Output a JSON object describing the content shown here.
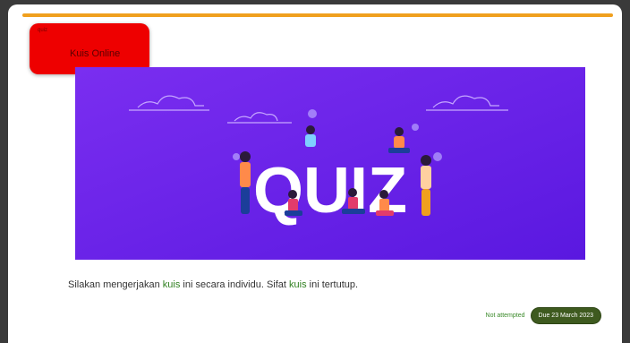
{
  "activity": {
    "tiny_label": "quiz",
    "title": "Kuis Online",
    "banner_word": "QUIZ",
    "description": {
      "part1": "Silakan mengerjakan ",
      "kw1": "kuis",
      "part2": " ini secara individu. Sifat ",
      "kw2": "kuis",
      "part3": " ini tertutup."
    },
    "status_text": "Not attempted",
    "due_badge": "Due 23 March 2023"
  },
  "colors": {
    "accent": "#f0a01e",
    "title_bg": "#ee0000",
    "banner_bg": "#6a1fe8",
    "keyword": "#2f7f1f",
    "badge_bg": "#3e5a1f"
  }
}
